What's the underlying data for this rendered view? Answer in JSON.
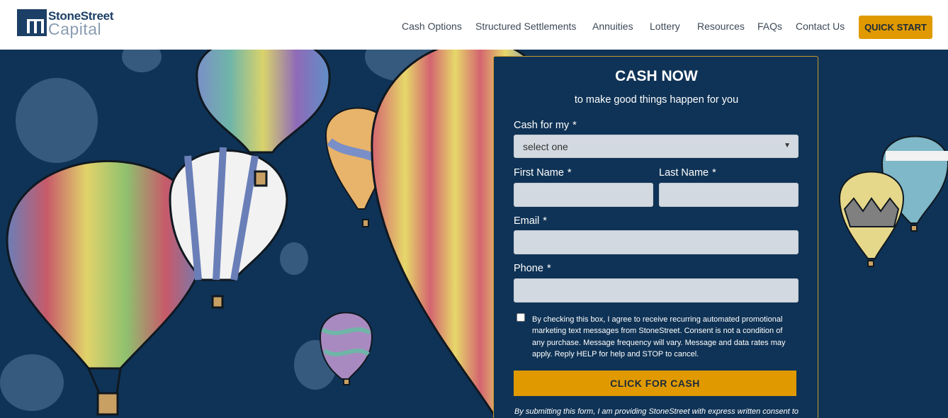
{
  "brand": {
    "name": "StoneStreet",
    "sub": "Capital"
  },
  "nav": {
    "items": [
      {
        "label": "Cash Options"
      },
      {
        "label": "Structured Settlements"
      },
      {
        "label": "Annuities"
      },
      {
        "label": "Lottery"
      },
      {
        "label": "Resources"
      },
      {
        "label": "FAQs"
      },
      {
        "label": "Contact Us"
      }
    ],
    "cta": "QUICK START"
  },
  "form": {
    "title": "CASH NOW",
    "subtitle": "to make good things happen for you",
    "cash_for_label": "Cash for my",
    "cash_for_value": "select one",
    "first_name_label": "First Name",
    "last_name_label": "Last Name",
    "email_label": "Email",
    "phone_label": "Phone",
    "required_marker": "*",
    "consent_text": "By checking this box, I agree to receive recurring automated promotional marketing text messages from StoneStreet. Consent is not a condition of any purchase. Message frequency will vary. Message and data rates may apply. Reply HELP for help and STOP to cancel.",
    "submit_label": "CLICK FOR CASH",
    "disclaimer": "By submitting this form, I am providing StoneStreet with express written consent to"
  },
  "colors": {
    "navy": "#0f3356",
    "accent": "#e09a00",
    "field": "#d3d9e0"
  }
}
